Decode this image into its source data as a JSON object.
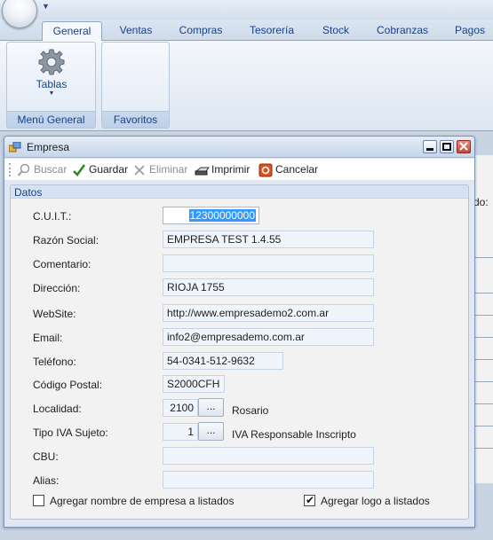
{
  "ribbon": {
    "tabs": [
      "General",
      "Ventas",
      "Compras",
      "Tesorería",
      "Stock",
      "Cobranzas",
      "Pagos"
    ],
    "active_tab": "General",
    "groups": {
      "menu_general": {
        "label": "Menú General",
        "button_label": "Tablas"
      },
      "favoritos": {
        "label": "Favoritos"
      }
    }
  },
  "background_form": {
    "partial_label": "do:"
  },
  "window": {
    "title": "Empresa",
    "toolbar": {
      "buscar": "Buscar",
      "guardar": "Guardar",
      "eliminar": "Eliminar",
      "imprimir": "Imprimir",
      "cancelar": "Cancelar"
    },
    "panel_title": "Datos",
    "fields": {
      "cuit": {
        "label": "C.U.I.T.:",
        "value": "12300000000"
      },
      "razon": {
        "label": "Razón Social:",
        "value": "EMPRESA TEST 1.4.55"
      },
      "comentario": {
        "label": "Comentario:",
        "value": ""
      },
      "direccion": {
        "label": "Dirección:",
        "value": "RIOJA 1755"
      },
      "website": {
        "label": "WebSite:",
        "value": "http://www.empresademo2.com.ar"
      },
      "email": {
        "label": "Email:",
        "value": "info2@empresademo.com.ar"
      },
      "telefono": {
        "label": "Teléfono:",
        "value": "54-0341-512-9632"
      },
      "postal": {
        "label": "Código Postal:",
        "value": "S2000CFH"
      },
      "localidad": {
        "label": "Localidad:",
        "value": "2100",
        "desc": "Rosario",
        "button": "..."
      },
      "tipo_iva": {
        "label": "Tipo IVA Sujeto:",
        "value": "1",
        "desc": "IVA Responsable Inscripto",
        "button": "..."
      },
      "cbu": {
        "label": "CBU:",
        "value": ""
      },
      "alias": {
        "label": "Alias:",
        "value": ""
      }
    },
    "checkboxes": {
      "nombre_listados": {
        "label": "Agregar nombre de empresa a listados",
        "checked": false
      },
      "logo_listados": {
        "label": "Agregar logo a listados",
        "checked": true
      }
    }
  },
  "colors": {
    "ribbon_text": "#15428b",
    "selection": "#3399ff",
    "close_button": "#c44a35",
    "guardar_check": "#2e8b1f",
    "cancelar_icon": "#d9531e"
  },
  "icons": [
    "gear-icon",
    "search-icon",
    "check-icon",
    "x-icon",
    "printer-icon",
    "cancel-icon",
    "window-icon"
  ]
}
